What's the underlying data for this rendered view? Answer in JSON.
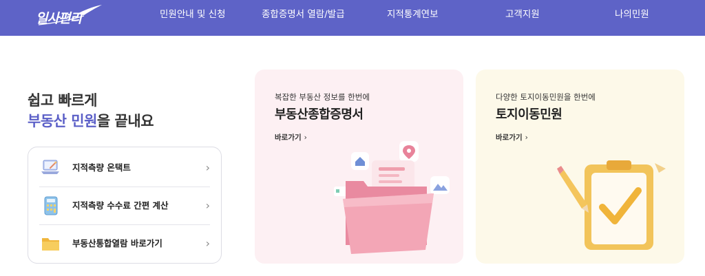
{
  "header": {
    "logo_text": "일사편리",
    "nav": [
      {
        "label": "민원안내 및 신청"
      },
      {
        "label": "종합증명서 열람/발급"
      },
      {
        "label": "지적통계연보"
      },
      {
        "label": "고객지원"
      },
      {
        "label": "나의민원"
      }
    ]
  },
  "hero": {
    "line1": "쉽고 빠르게",
    "line2_accent": "부동산 민원",
    "line2_rest": "을 끝내요"
  },
  "quick_menu": [
    {
      "label": "지적측량 온택트",
      "icon": "laptop-icon"
    },
    {
      "label": "지적측량 수수료 간편 계산",
      "icon": "calculator-icon"
    },
    {
      "label": "부동산통합열람 바로가기",
      "icon": "folder-icon"
    }
  ],
  "cards": [
    {
      "subtitle": "복잡한 부동산 정보를 한번에",
      "title": "부동산종합증명서",
      "link": "바로가기",
      "bg": "#fdf0f3",
      "icon": "open-folder-document-icon"
    },
    {
      "subtitle": "다양한 토지이동민원을 한번에",
      "title": "토지이동민원",
      "link": "바로가기",
      "bg": "#fdf9e9",
      "icon": "clipboard-check-pencil-icon"
    }
  ],
  "colors": {
    "header_bg": "#5e63c7",
    "accent": "#5b5fc7"
  }
}
